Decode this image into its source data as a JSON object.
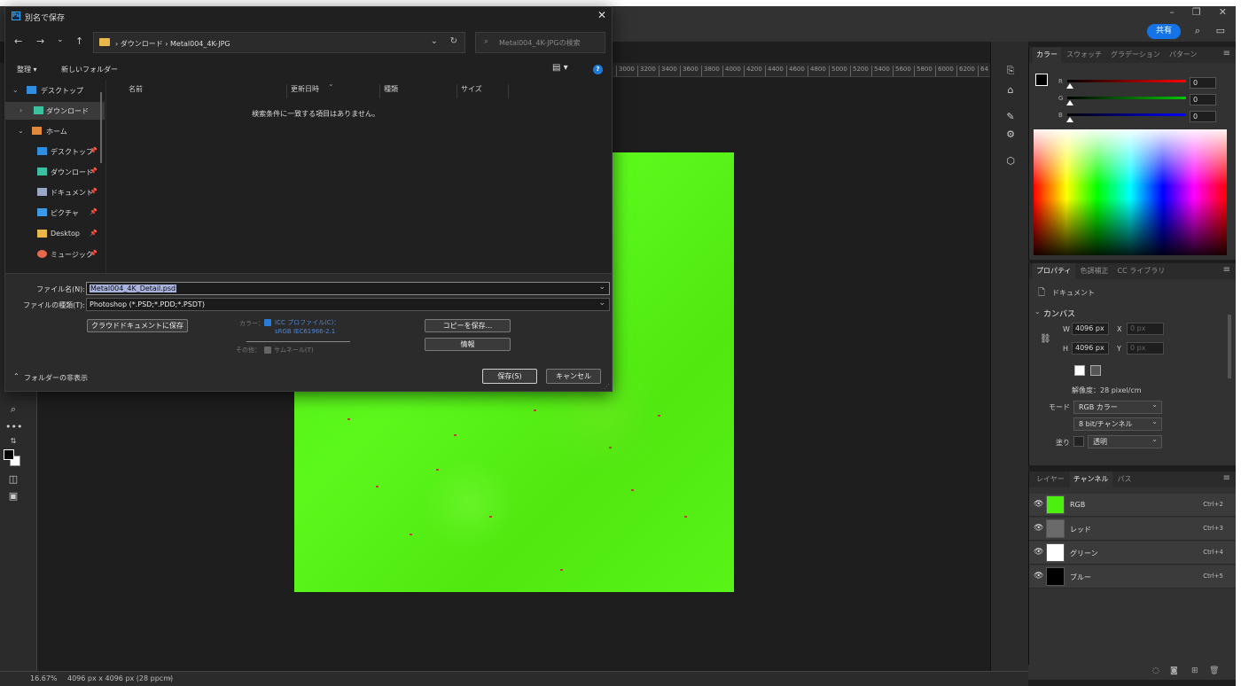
{
  "ps": {
    "share_label": "共有",
    "ruler_ticks": [
      "3000",
      "3200",
      "3400",
      "3600",
      "3800",
      "4000",
      "4200",
      "4400",
      "4600",
      "4800",
      "5000",
      "5200",
      "5400",
      "5600",
      "5800",
      "6000",
      "6200",
      "64"
    ],
    "status": {
      "zoom": "16.67%",
      "doc_info": "4096 px x 4096 px (28 ppcm)",
      "arrow": "›"
    }
  },
  "color_panel": {
    "tabs": [
      "カラー",
      "スウォッチ",
      "グラデーション",
      "パターン"
    ],
    "channels": [
      {
        "label": "R",
        "value": "0"
      },
      {
        "label": "G",
        "value": "0"
      },
      {
        "label": "B",
        "value": "0"
      }
    ],
    "colors": {
      "r": "#ff0000",
      "g": "#00c800",
      "b": "#0000ff"
    }
  },
  "props_panel": {
    "tabs": [
      "プロパティ",
      "色調補正",
      "CC ライブラリ"
    ],
    "doc_label": "ドキュメント",
    "section": "カンバス",
    "w_label": "W",
    "w_value": "4096 px",
    "x_label": "X",
    "x_value": "0 px",
    "h_label": "H",
    "h_value": "4096 px",
    "y_label": "Y",
    "y_value": "0 px",
    "resolution": "解像度：28 pixel/cm",
    "mode_label": "モード",
    "mode_value": "RGB カラー",
    "depth_value": "8 bit/チャンネル",
    "fill_label": "塗り",
    "fill_value": "透明"
  },
  "layers_panel": {
    "tabs": [
      "レイヤー",
      "チャンネル",
      "パス"
    ],
    "channels": [
      {
        "name": "RGB",
        "key": "Ctrl+2",
        "thumb": "#4cf00f"
      },
      {
        "name": "レッド",
        "key": "Ctrl+3",
        "thumb": "#6a6a6a"
      },
      {
        "name": "グリーン",
        "key": "Ctrl+4",
        "thumb": "#ffffff"
      },
      {
        "name": "ブルー",
        "key": "Ctrl+5",
        "thumb": "#000000"
      }
    ]
  },
  "dialog": {
    "title": "別名で保存",
    "breadcrumb": "›  ダウンロード  ›  Metal004_4K-JPG",
    "search_placeholder": "Metal004_4K-JPGの検索",
    "organize": "整理 ▾",
    "new_folder": "新しいフォルダー",
    "nav_items": [
      {
        "label": "デスクトップ",
        "color": "#2f8ee0",
        "chev": "⌄",
        "pin": ""
      },
      {
        "label": "ダウンロード",
        "color": "#3cc1a0",
        "chev": "›",
        "pin": ""
      },
      {
        "label": "ホーム",
        "color": "#e08a3c",
        "chev": "⌄",
        "pin": ""
      },
      {
        "label": "デスクトップ",
        "color": "#2f8ee0",
        "chev": "",
        "pin": "📌"
      },
      {
        "label": "ダウンロード",
        "color": "#3cc1a0",
        "chev": "",
        "pin": "📌"
      },
      {
        "label": "ドキュメント",
        "color": "#9aa8c8",
        "chev": "",
        "pin": "📌"
      },
      {
        "label": "ピクチャ",
        "color": "#3a9ae8",
        "chev": "",
        "pin": "📌"
      },
      {
        "label": "Desktop",
        "color": "#e8b84a",
        "chev": "",
        "pin": "📌"
      },
      {
        "label": "ミュージック",
        "color": "#e86a4a",
        "chev": "",
        "pin": "📌"
      }
    ],
    "columns": [
      "名前",
      "更新日時",
      "種類",
      "サイズ"
    ],
    "empty_message": "検索条件に一致する項目はありません。",
    "filename_label": "ファイル名(N):",
    "filename_value": "Metal004_4K_Detail.psd",
    "filetype_label": "ファイルの種類(T):",
    "filetype_value": "Photoshop (*.PSD;*.PDD;*.PSDT)",
    "cloud_button": "クラウドドキュメントに保存",
    "color_label": "カラー：",
    "icc_label": "ICC プロファイル(C)：",
    "icc_value": "sRGB IEC61966-2.1",
    "other_label": "その他：",
    "thumbnail_label": "サムネール(T)",
    "copy_button": "コピーを保存...",
    "info_button": "情報",
    "hide_folders": "フォルダーの非表示",
    "save_button": "保存(S)",
    "cancel_button": "キャンセル"
  }
}
